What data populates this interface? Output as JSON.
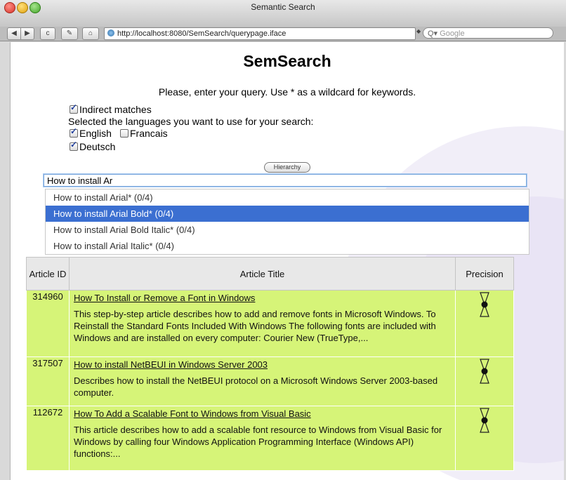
{
  "window": {
    "title": "Semantic Search"
  },
  "toolbar": {
    "back": "◀",
    "forward": "▶",
    "reload": "c",
    "edit": "✎",
    "home": "⌂",
    "url": "http://localhost:8080/SemSearch/querypage.iface",
    "search_placeholder": "Google",
    "search_glass": "Q▾"
  },
  "page": {
    "title": "SemSearch",
    "instruction": "Please, enter your query. Use * as a wildcard for keywords.",
    "indirect_label": "Indirect matches",
    "indirect_checked": true,
    "languages_prompt": "Selected the languages you want to use for your search:",
    "languages": [
      {
        "label": "English",
        "checked": true
      },
      {
        "label": "Francais",
        "checked": false
      },
      {
        "label": "Deutsch",
        "checked": true
      }
    ],
    "hierarchy_button": "Hierarchy",
    "query_value": "How to install Ar"
  },
  "suggestions": [
    {
      "text": "How to install Arial* (0/4)",
      "selected": false
    },
    {
      "text": "How to install Arial Bold* (0/4)",
      "selected": true
    },
    {
      "text": "How to install Arial Bold Italic* (0/4)",
      "selected": false
    },
    {
      "text": "How to install Arial Italic* (0/4)",
      "selected": false
    }
  ],
  "table": {
    "headers": {
      "id": "Article ID",
      "title": "Article Title",
      "precision": "Precision"
    },
    "rows": [
      {
        "id": "314960",
        "title": "How To Install or Remove a Font in Windows",
        "description": "This step-by-step article describes how to add and remove fonts in Microsoft Windows. To Reinstall the Standard Fonts Included With Windows The following fonts are included with Windows and are installed on every computer: Courier New (TrueType,...",
        "precision": 0.5
      },
      {
        "id": "317507",
        "title": "How to install NetBEUI in Windows Server 2003",
        "description": "Describes how to install the NetBEUI protocol on a Microsoft Windows Server 2003-based computer.",
        "precision": 0.5
      },
      {
        "id": "112672",
        "title": "How To Add a Scalable Font to Windows from Visual Basic",
        "description": "This article describes how to add a scalable font resource to Windows from Visual Basic for Windows by calling four Windows Application Programming Interface (Windows API) functions:...",
        "precision": 0.5
      }
    ]
  },
  "colors": {
    "accent": "#3b6fd1",
    "result_row": "#d6f478",
    "header_bg": "#e8e8e8"
  },
  "icons": {
    "precision": "hourglass-icon",
    "url": "globe-icon",
    "search": "search-icon"
  }
}
